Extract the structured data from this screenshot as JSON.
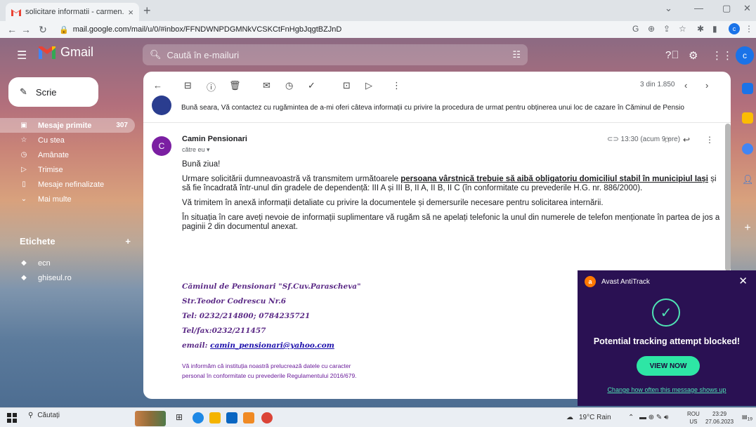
{
  "browser": {
    "tab_title": "solicitare informatii - carmen.ca",
    "tab_close": "×",
    "new_tab": "+",
    "url": "mail.google.com/mail/u/0/#inbox/FFNDWNPDGMNkVCSKCtFnHgbJqgtBZJnD",
    "window_controls": [
      "⌄",
      "—",
      "▢",
      "✕"
    ],
    "profile_initial": "c"
  },
  "gmail": {
    "brand": "Gmail",
    "search_placeholder": "Caută în e-mailuri",
    "account_initial": "c",
    "compose_label": "Scrie",
    "nav": [
      {
        "label": "Mesaje primite",
        "count": "307",
        "icon": "inbox-icon"
      },
      {
        "label": "Cu stea",
        "icon": "star-icon"
      },
      {
        "label": "Amânate",
        "icon": "clock-icon"
      },
      {
        "label": "Trimise",
        "icon": "send-icon"
      },
      {
        "label": "Mesaje nefinalizate",
        "icon": "draft-icon"
      },
      {
        "label": "Mai multe",
        "icon": "chevron-down-icon"
      }
    ],
    "labels_header": "Etichete",
    "labels_add": "+",
    "labels": [
      {
        "label": "ecn"
      },
      {
        "label": "ghiseul.ro"
      }
    ]
  },
  "thread": {
    "pager": "3 din 1.850",
    "prev_snippet": "Bună seara, Vă contactez cu rugămintea de a-mi oferi câteva informații cu privire la procedura de urmat pentru obținerea unui loc de cazare în Căminul de Pensio",
    "message": {
      "avatar_initial": "C",
      "sender": "Camin Pensionari",
      "to": "către eu ▾",
      "time": "13:30 (acum 9 ore)",
      "greeting": "Bună ziua!",
      "p1_start": "Urmare solicitării dumneavoastră vă transmitem următoarele ",
      "p1_bold": "persoana vârstnică trebuie să aibă obligatoriu domiciliul stabil în municipiul Iași",
      "p1_end": " și să fie încadrată într-unul din gradele de dependență: III A și III B, II A, II B, II C (în conformitate cu prevederile H.G. nr. 886/2000).",
      "p2": "Vă trimitem în anexă informații detaliate cu privire la documentele și demersurile necesare pentru solicitarea internării.",
      "p3": "În situația în care aveți nevoie de informații suplimentare vă rugăm să ne apelați telefonic la unul din numerele de telefon menționate în partea de jos a paginii 2 din documentul anexat.",
      "sig": {
        "line1": "Căminul de Pensionari \"Sf.Cuv.Parascheva\"",
        "line2": "Str.Teodor Codrescu Nr.6",
        "line3": "Tel: 0232/214800; 0784235721",
        "line4": "Tel/fax:0232/211457",
        "email_label": "email: ",
        "email": "camin_pensionari@yahoo.com"
      },
      "disclaimer1": "Vă informăm că instituția noastră prelucrează datele cu caracter",
      "disclaimer2": "personal în conformitate cu prevederile Regulamentului 2016/679."
    }
  },
  "avast": {
    "brand": "Avast AntiTrack",
    "title": "Potential tracking attempt blocked!",
    "button": "VIEW NOW",
    "link": "Change how often this message shows up"
  },
  "taskbar": {
    "search": "Căutați",
    "weather": "19°C Rain",
    "lang1": "ROU",
    "lang2": "US",
    "time": "23:29",
    "date": "27.06.2023",
    "notif": "19"
  },
  "colors": {
    "accent": "#1a73e8",
    "avast_bg": "#2a1153",
    "avast_green": "#2ee6a5",
    "signature": "#5b2a86"
  }
}
